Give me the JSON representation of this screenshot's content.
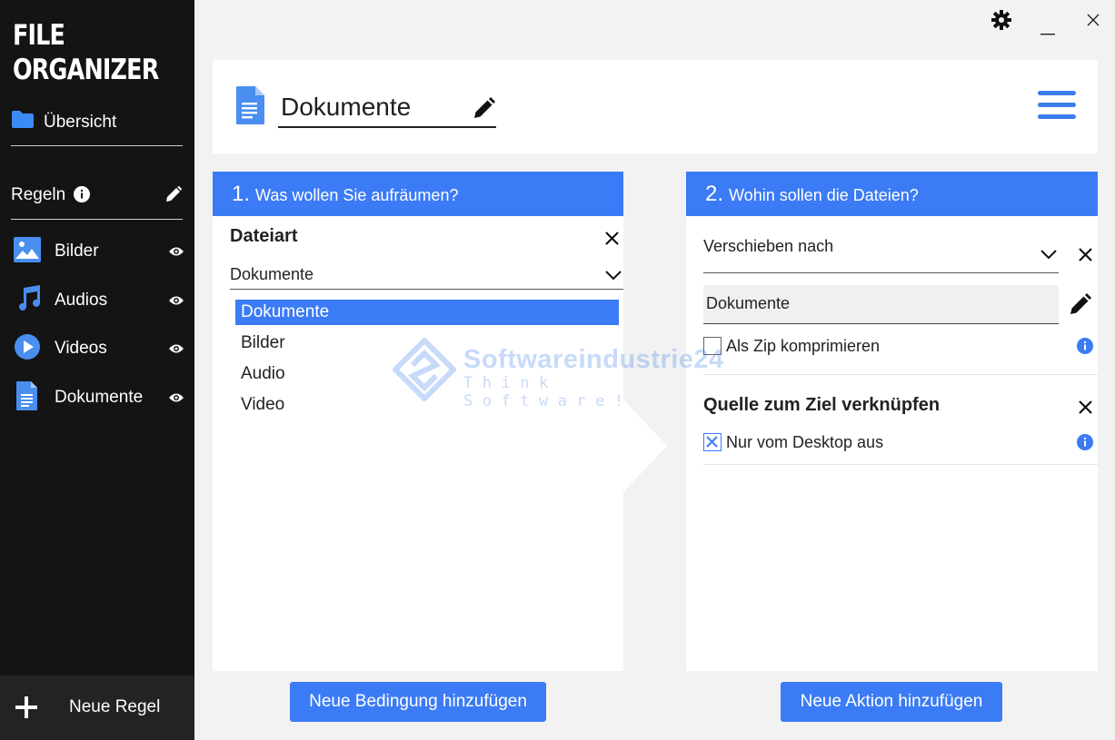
{
  "app": {
    "logo_line1": "FILE",
    "logo_line2": "ORGANIZER",
    "accent_color": "#3b7bf5"
  },
  "sidebar": {
    "overview_label": "Übersicht",
    "rules_label": "Regeln",
    "items": [
      {
        "label": "Bilder",
        "icon": "image-icon"
      },
      {
        "label": "Audios",
        "icon": "music-icon"
      },
      {
        "label": "Videos",
        "icon": "play-icon"
      },
      {
        "label": "Dokumente",
        "icon": "document-icon"
      }
    ],
    "new_rule_label": "Neue Regel"
  },
  "header": {
    "rule_name": "Dokumente"
  },
  "left_panel": {
    "number": "1.",
    "title": "Was wollen Sie aufräumen?",
    "condition_label": "Dateiart",
    "selected_value": "Dokumente",
    "options": [
      "Dokumente",
      "Bilder",
      "Audio",
      "Video"
    ],
    "add_button": "Neue Bedingung hinzufügen"
  },
  "right_panel": {
    "number": "2.",
    "title": "Wohin sollen die Dateien?",
    "action_value": "Verschieben nach",
    "target_folder": "Dokumente",
    "zip_label": "Als Zip komprimieren",
    "zip_checked": false,
    "link_title": "Quelle zum Ziel verknüpfen",
    "desktop_label": "Nur vom Desktop aus",
    "desktop_checked": true,
    "add_button": "Neue Aktion hinzufügen"
  },
  "watermark": {
    "title": "Softwareindustrie24",
    "subtitle": "Think Software!"
  }
}
